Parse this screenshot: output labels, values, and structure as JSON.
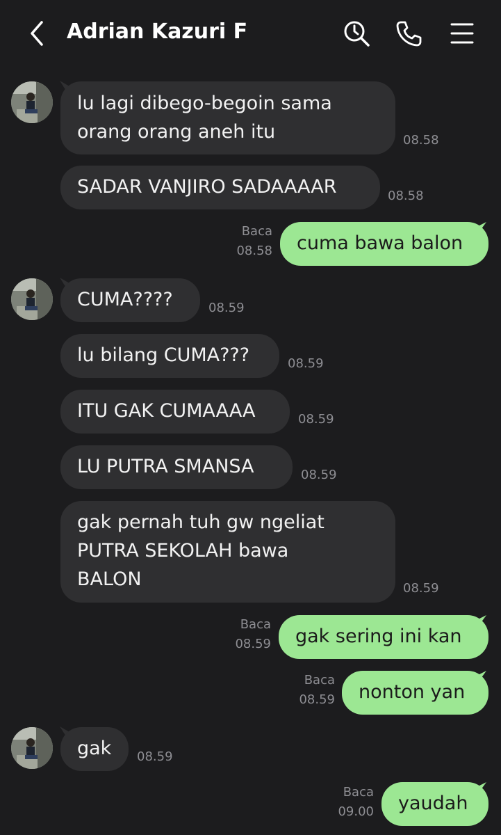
{
  "header": {
    "title": "Adrian Kazuri F",
    "icons": [
      "back-chevron-icon",
      "search-history-icon",
      "phone-icon",
      "menu-icon"
    ]
  },
  "colors": {
    "background": "#1c1c1e",
    "incoming_bubble": "#2f2f31",
    "outgoing_bubble": "#9ce793",
    "timestamp": "#8e8e93"
  },
  "messages": [
    {
      "from": "them",
      "lines": [
        "lu lagi dibego-begoin sama",
        "orang orang aneh itu"
      ],
      "time": "08.58"
    },
    {
      "from": "them",
      "lines": [
        "SADAR VANJIRO SADAAAAR"
      ],
      "time": "08.58"
    },
    {
      "from": "me",
      "lines": [
        "cuma bawa balon"
      ],
      "status": "Baca",
      "time": "08.58"
    },
    {
      "from": "them",
      "lines": [
        "CUMA????"
      ],
      "time": "08.59"
    },
    {
      "from": "them",
      "lines": [
        "lu bilang CUMA???"
      ],
      "time": "08.59"
    },
    {
      "from": "them",
      "lines": [
        "ITU GAK CUMAAAA"
      ],
      "time": "08.59"
    },
    {
      "from": "them",
      "lines": [
        "LU PUTRA SMANSA"
      ],
      "time": "08.59"
    },
    {
      "from": "them",
      "lines": [
        "gak pernah tuh gw ngeliat",
        "PUTRA SEKOLAH bawa",
        "BALON"
      ],
      "time": "08.59"
    },
    {
      "from": "me",
      "lines": [
        "gak sering ini kan"
      ],
      "status": "Baca",
      "time": "08.59"
    },
    {
      "from": "me",
      "lines": [
        "nonton yan"
      ],
      "status": "Baca",
      "time": "08.59"
    },
    {
      "from": "them",
      "lines": [
        "gak"
      ],
      "time": "08.59"
    },
    {
      "from": "me",
      "lines": [
        "yaudah"
      ],
      "status": "Baca",
      "time": "09.00"
    }
  ]
}
